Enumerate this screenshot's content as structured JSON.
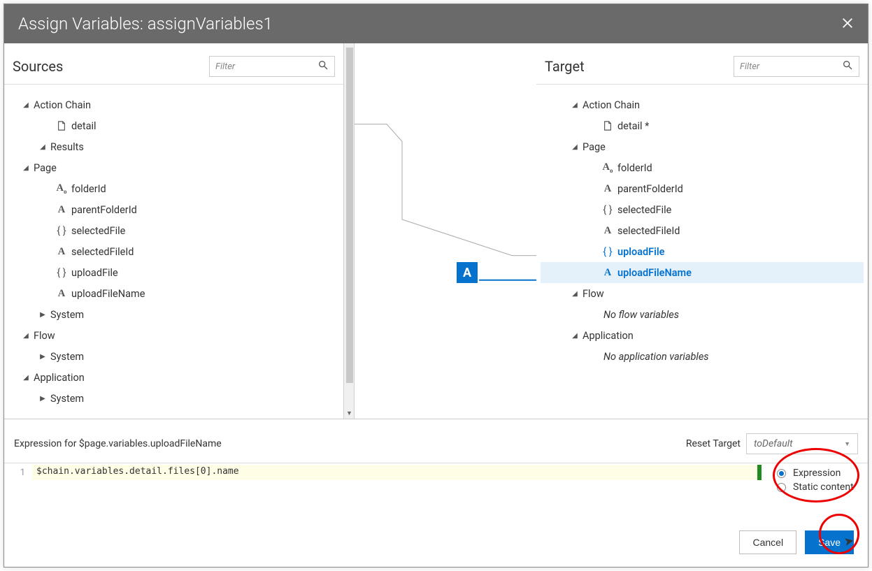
{
  "title": "Assign Variables: assignVariables1",
  "panels": {
    "sources": {
      "title": "Sources",
      "filter_placeholder": "Filter"
    },
    "target": {
      "title": "Target",
      "filter_placeholder": "Filter"
    }
  },
  "sources_tree": {
    "action_chain": "Action Chain",
    "detail": "detail",
    "results": "Results",
    "page": "Page",
    "folderId": "folderId",
    "parentFolderId": "parentFolderId",
    "selectedFile": "selectedFile",
    "selectedFileId": "selectedFileId",
    "uploadFile": "uploadFile",
    "uploadFileName": "uploadFileName",
    "system": "System",
    "flow": "Flow",
    "application": "Application"
  },
  "target_tree": {
    "action_chain": "Action Chain",
    "detail": "detail *",
    "page": "Page",
    "folderId": "folderId",
    "parentFolderId": "parentFolderId",
    "selectedFile": "selectedFile",
    "selectedFileId": "selectedFileId",
    "uploadFile": "uploadFile",
    "uploadFileName": "uploadFileName",
    "flow": "Flow",
    "no_flow": "No flow variables",
    "application": "Application",
    "no_app": "No application variables"
  },
  "middle": {
    "badge": "A"
  },
  "expression": {
    "label_prefix": "Expression for ",
    "label_path": "$page.variables.uploadFileName",
    "reset_label": "Reset Target",
    "reset_value": "toDefault",
    "line_no": "1",
    "code": "$chain.variables.detail.files[0].name",
    "mode_expression": "Expression",
    "mode_static": "Static content"
  },
  "buttons": {
    "cancel": "Cancel",
    "save": "Save"
  }
}
